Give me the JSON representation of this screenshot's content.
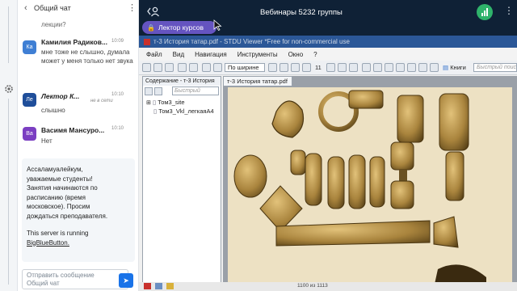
{
  "chat": {
    "back_label": "Общий чат",
    "more_icon": "more-vertical-icon",
    "truncated_prev": "лекции?",
    "messages": [
      {
        "initials": "Ка",
        "name": "Камилия Радиков...",
        "time": "10:09",
        "text": "мне тоже не слышно, думала может у меня только нет звука",
        "color": "#3f7fd4"
      },
      {
        "initials": "Ле",
        "name": "Лектор К...",
        "time": "10:10",
        "status": "не в сети",
        "text": "слышно",
        "color": "#1f4e9a"
      },
      {
        "initials": "Ва",
        "name": "Васимя Мансуро...",
        "time": "10:10",
        "text": "Нет",
        "color": "#7b3fc2"
      }
    ],
    "welcome": {
      "line1": "Ассаламуалейкум,",
      "line2": "уважаемые студенты!",
      "line3": "Занятия начинаются по",
      "line4": "расписанию (время",
      "line5": "московское). Просим",
      "line6": "дождаться преподавателя.",
      "server_line": "This server is running",
      "server_link": "BigBlueButton."
    },
    "input_placeholder_1": "Отправить сообщение",
    "input_placeholder_2": "Общий чат",
    "send_icon": "send-icon"
  },
  "topbar": {
    "title": "Вебинары 5232 группы",
    "presenter_badge": "Лектор курсов",
    "user_icon": "user-list-icon",
    "signal_icon": "connection-signal-icon",
    "more_icon": "more-vertical-icon"
  },
  "viewer": {
    "window_title": "т-3 История татар.pdf - STDU Viewer *Free for non-commercial use",
    "menus": [
      "Файл",
      "Вид",
      "Навигация",
      "Инструменты",
      "Окно",
      "?"
    ],
    "zoom_label": "По ширине",
    "page_number": "11",
    "books_label": "Книги",
    "quick_search": "Быстрый поис",
    "sidebar_title": "Содержание - т-3 История",
    "sidebar_search": "Быстрый",
    "tree": [
      "Том3_site",
      "Том3_Vkl_легкаяA4"
    ],
    "doc_tab": "т-3 История татар.pdf",
    "status_page": "1100 из 1113"
  },
  "colors": {
    "topbar_bg": "#0f2136",
    "presenter": "#6554c0",
    "send": "#1a73e8",
    "window_title": "#2b5797",
    "page_bg": "#ede1c3"
  }
}
